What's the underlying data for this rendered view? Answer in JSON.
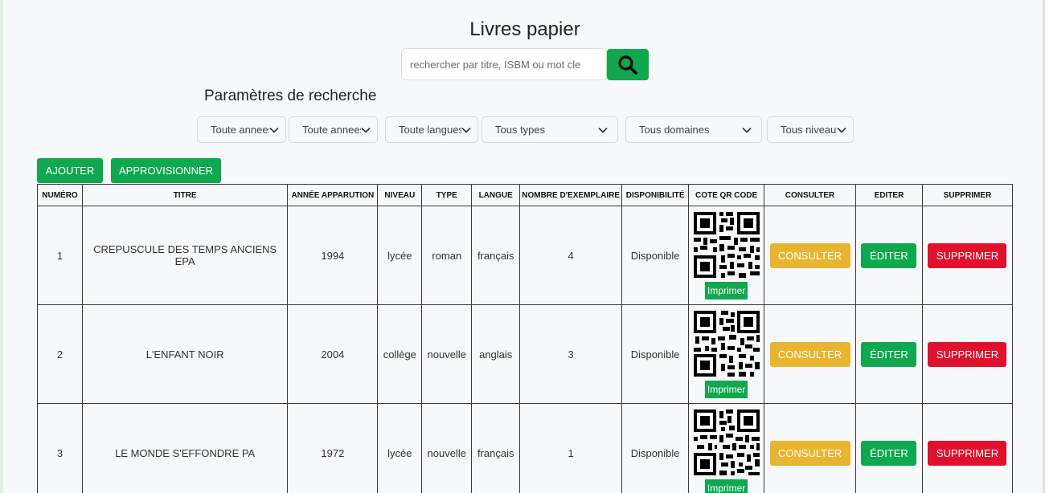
{
  "header": {
    "title": "Livres papier"
  },
  "search": {
    "placeholder": "rechercher par titre, ISBM ou mot cle"
  },
  "params": {
    "title": "Paramètres de recherche",
    "filters": [
      "Toute annees",
      "Toute annees",
      "Toute langues",
      "Tous types",
      "Tous domaines",
      "Tous niveaux"
    ]
  },
  "actions": {
    "add": "AJOUTER",
    "supply": "APPROVISIONNER"
  },
  "table": {
    "headers": [
      "NUMÉRO",
      "TITRE",
      "ANNÉE APPARUTION",
      "NIVEAU",
      "TYPE",
      "LANGUE",
      "NOMBRE D'EXEMPLAIRE",
      "DISPONIBILITÉ",
      "COTE QR CODE",
      "CONSULTER",
      "EDITER",
      "SUPPRIMER"
    ],
    "print_label": "Imprimer",
    "consult_label": "CONSULTER",
    "edit_label": "ÉDITER",
    "delete_label": "SUPPRIMER",
    "rows": [
      {
        "num": "1",
        "titre": "CREPUSCULE DES TEMPS ANCIENS EPA",
        "annee": "1994",
        "niveau": "lycée",
        "type": "roman",
        "langue": "français",
        "exemplaires": "4",
        "dispo": "Disponible"
      },
      {
        "num": "2",
        "titre": "L'ENFANT NOIR",
        "annee": "2004",
        "niveau": "collège",
        "type": "nouvelle",
        "langue": "anglais",
        "exemplaires": "3",
        "dispo": "Disponible"
      },
      {
        "num": "3",
        "titre": "LE MONDE S'EFFONDRE PA",
        "annee": "1972",
        "niveau": "lycée",
        "type": "nouvelle",
        "langue": "français",
        "exemplaires": "1",
        "dispo": "Disponible"
      }
    ]
  },
  "colors": {
    "green": "#0fa84f",
    "yellow": "#e8b531",
    "red": "#e0112c",
    "available": "#1aa856"
  }
}
